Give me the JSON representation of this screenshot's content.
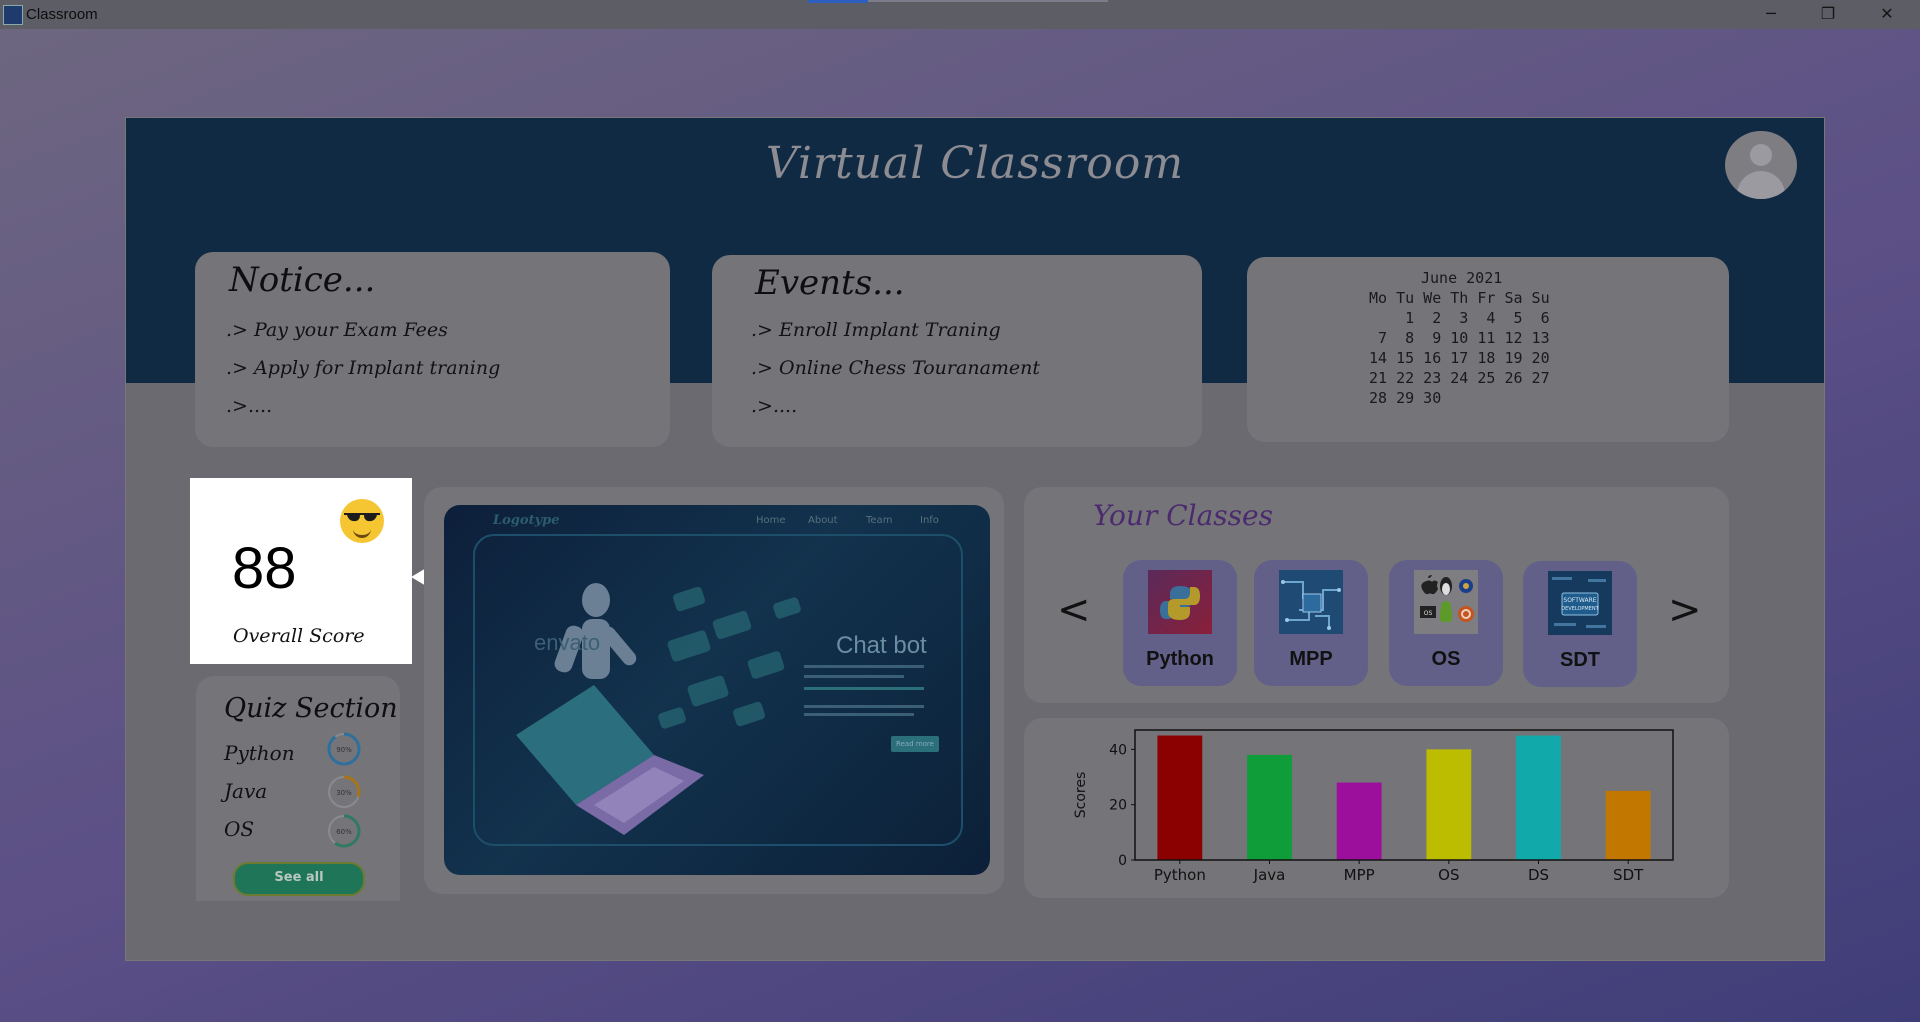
{
  "window": {
    "title": "Classroom",
    "minimize": "─",
    "maximize": "❐",
    "close": "✕"
  },
  "app_title": "Virtual Classroom",
  "notice": {
    "heading": "Notice...",
    "items": [
      ".> Pay your Exam Fees",
      ".> Apply for Implant traning",
      ".>...."
    ]
  },
  "events": {
    "heading": "Events...",
    "items": [
      ".> Enroll Implant Traning",
      ".> Online Chess Touranament",
      ".>...."
    ]
  },
  "calendar": {
    "month": "June 2021",
    "weekdays": "Mo Tu We Th Fr Sa Su",
    "weeks": [
      "    1  2  3  4  5  6",
      " 7  8  9 10 11 12 13",
      "14 15 16 17 18 19 20",
      "21 22 23 24 25 26 27",
      "28 29 30"
    ]
  },
  "score": {
    "value": "88",
    "label": "Overall Score"
  },
  "quiz": {
    "heading": "Quiz Section",
    "items": [
      {
        "name": "Python",
        "percent": 90,
        "percent_label": "90%",
        "color": "#2f6f9c"
      },
      {
        "name": "Java",
        "percent": 30,
        "percent_label": "30%",
        "color": "#a8741a"
      },
      {
        "name": "OS",
        "percent": 60,
        "percent_label": "60%",
        "color": "#2f7a60"
      }
    ],
    "see_all": "See all"
  },
  "banner": {
    "logo": "Logotype",
    "nav": [
      "Home",
      "About",
      "Team",
      "Info"
    ],
    "watermark": "envato",
    "headline": "Chat bot",
    "button": "Read more"
  },
  "classes": {
    "heading": "Your Classes",
    "prev": "<",
    "next": ">",
    "items": [
      {
        "label": "Python",
        "icon": "python-logo-icon"
      },
      {
        "label": "MPP",
        "icon": "circuit-board-icon"
      },
      {
        "label": "OS",
        "icon": "os-logos-icon"
      },
      {
        "label": "SDT",
        "icon": "software-development-icon"
      }
    ]
  },
  "chart_data": {
    "type": "bar",
    "categories": [
      "Python",
      "Java",
      "MPP",
      "OS",
      "DS",
      "SDT"
    ],
    "values": [
      45,
      38,
      28,
      40,
      45,
      25
    ],
    "colors": [
      "#8b0000",
      "#0f9d3a",
      "#9c0f9c",
      "#bcbc00",
      "#11a9a9",
      "#c27800"
    ],
    "ylabel": "Scores",
    "ylim": [
      0,
      47
    ],
    "yticks": [
      0,
      20,
      40
    ],
    "grid": false
  }
}
